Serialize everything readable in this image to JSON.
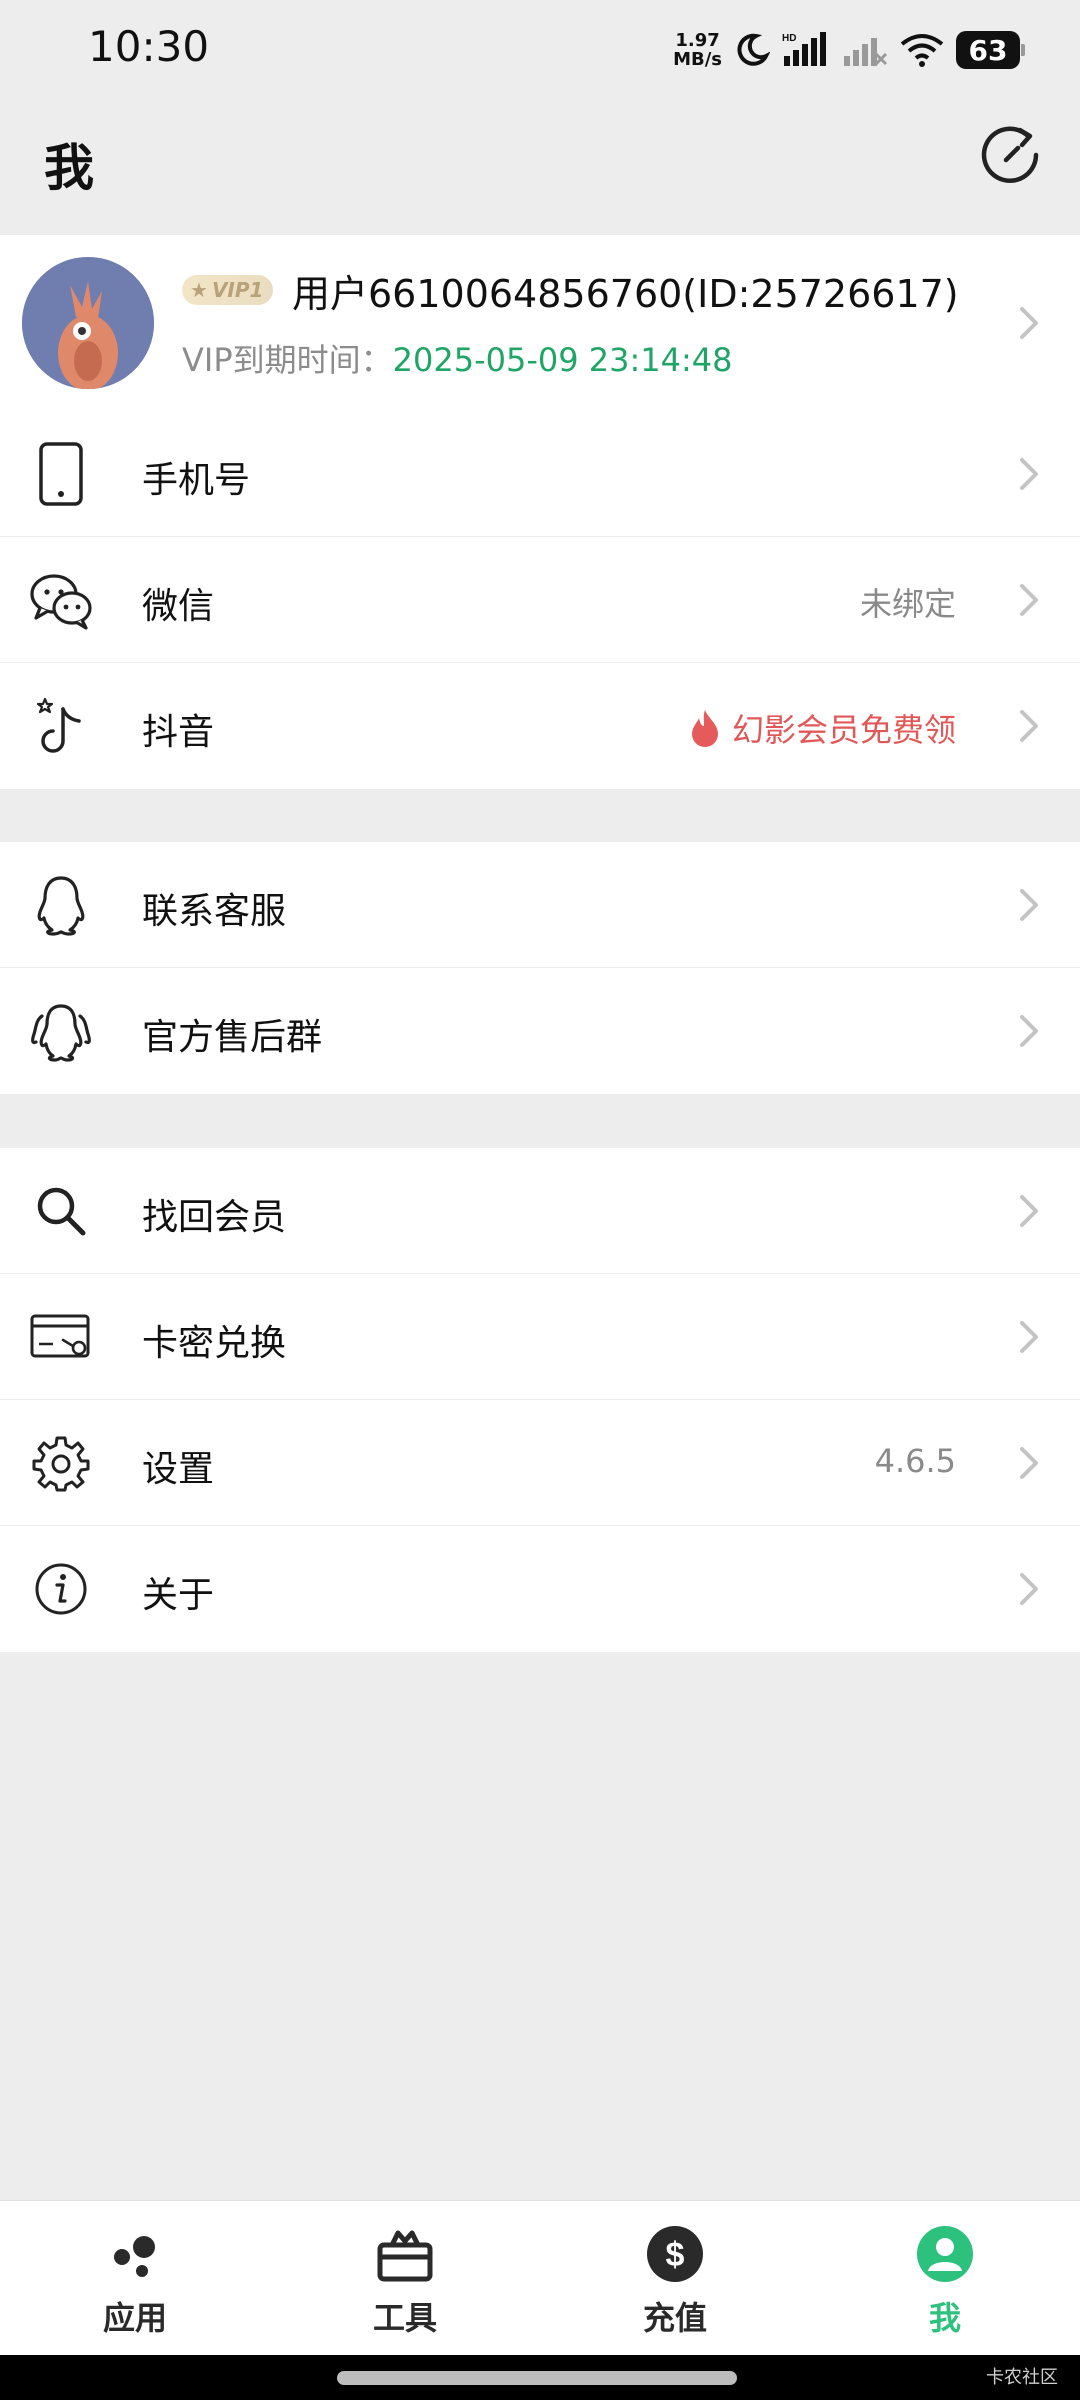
{
  "status_bar": {
    "time": "10:30",
    "net_speed_value": "1.97",
    "net_speed_unit": "MB/s",
    "battery": "63"
  },
  "header": {
    "title": "我"
  },
  "profile": {
    "vip_badge": "VIP1",
    "username": "用户6610064856760(ID:25726617)",
    "vip_expire_label": "VIP到期时间：",
    "vip_expire_value": "2025-05-09 23:14:48"
  },
  "groups": [
    {
      "items": [
        {
          "label": "手机号",
          "value": "",
          "icon": "phone-icon"
        },
        {
          "label": "微信",
          "value": "未绑定",
          "icon": "wechat-icon"
        },
        {
          "label": "抖音",
          "value": "幻影会员免费领",
          "icon": "douyin-icon",
          "value_color": "#e05858"
        }
      ]
    },
    {
      "items": [
        {
          "label": "联系客服",
          "value": "",
          "icon": "qq-icon"
        },
        {
          "label": "官方售后群",
          "value": "",
          "icon": "qq-group-icon"
        }
      ]
    },
    {
      "items": [
        {
          "label": "找回会员",
          "value": "",
          "icon": "search-icon"
        },
        {
          "label": "卡密兑换",
          "value": "",
          "icon": "card-key-icon"
        },
        {
          "label": "设置",
          "value": "4.6.5",
          "icon": "gear-icon"
        },
        {
          "label": "关于",
          "value": "",
          "icon": "info-icon"
        }
      ]
    }
  ],
  "bottom_nav": [
    {
      "label": "应用",
      "icon": "apps-icon",
      "active": false
    },
    {
      "label": "工具",
      "icon": "toolbox-icon",
      "active": false
    },
    {
      "label": "充值",
      "icon": "dollar-icon",
      "active": false
    },
    {
      "label": "我",
      "icon": "profile-icon",
      "active": true
    }
  ],
  "colors": {
    "accent_green": "#2cc17c",
    "vip_date_green": "#1fa565",
    "promo_red": "#e05858",
    "background": "#ededed"
  },
  "watermark": "卡农社区"
}
